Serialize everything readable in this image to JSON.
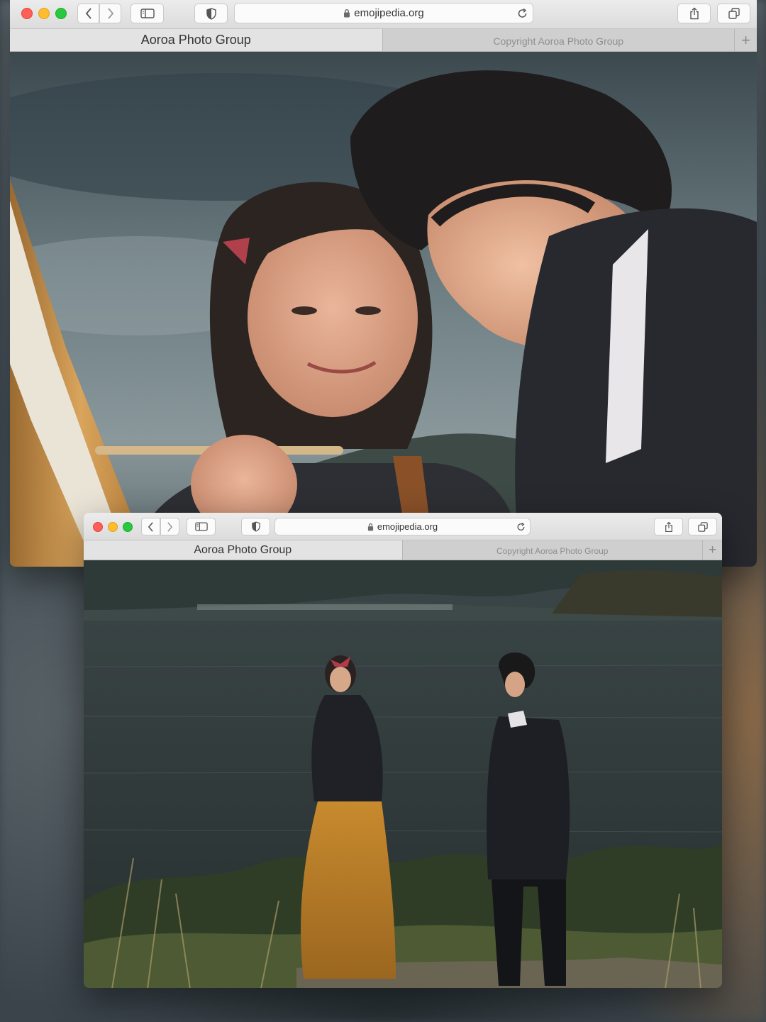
{
  "windows": [
    {
      "address": {
        "domain": "emojipedia.org"
      },
      "tabs": [
        {
          "label": "Aoroa Photo Group",
          "active": true
        },
        {
          "label": "Copyright Aoroa Photo Group",
          "active": false
        }
      ],
      "new_tab_label": "+"
    },
    {
      "address": {
        "domain": "emojipedia.org"
      },
      "tabs": [
        {
          "label": "Aoroa Photo Group",
          "active": true
        },
        {
          "label": "Copyright Aoroa Photo Group",
          "active": false
        }
      ],
      "new_tab_label": "+"
    }
  ],
  "colors": {
    "close": "#fe5f57",
    "minimize": "#febc2e",
    "zoom": "#28c840"
  },
  "icons": [
    "back-icon",
    "forward-icon",
    "sidebar-icon",
    "privacy-shield-icon",
    "lock-icon",
    "reload-icon",
    "share-icon",
    "tabs-overview-icon"
  ]
}
